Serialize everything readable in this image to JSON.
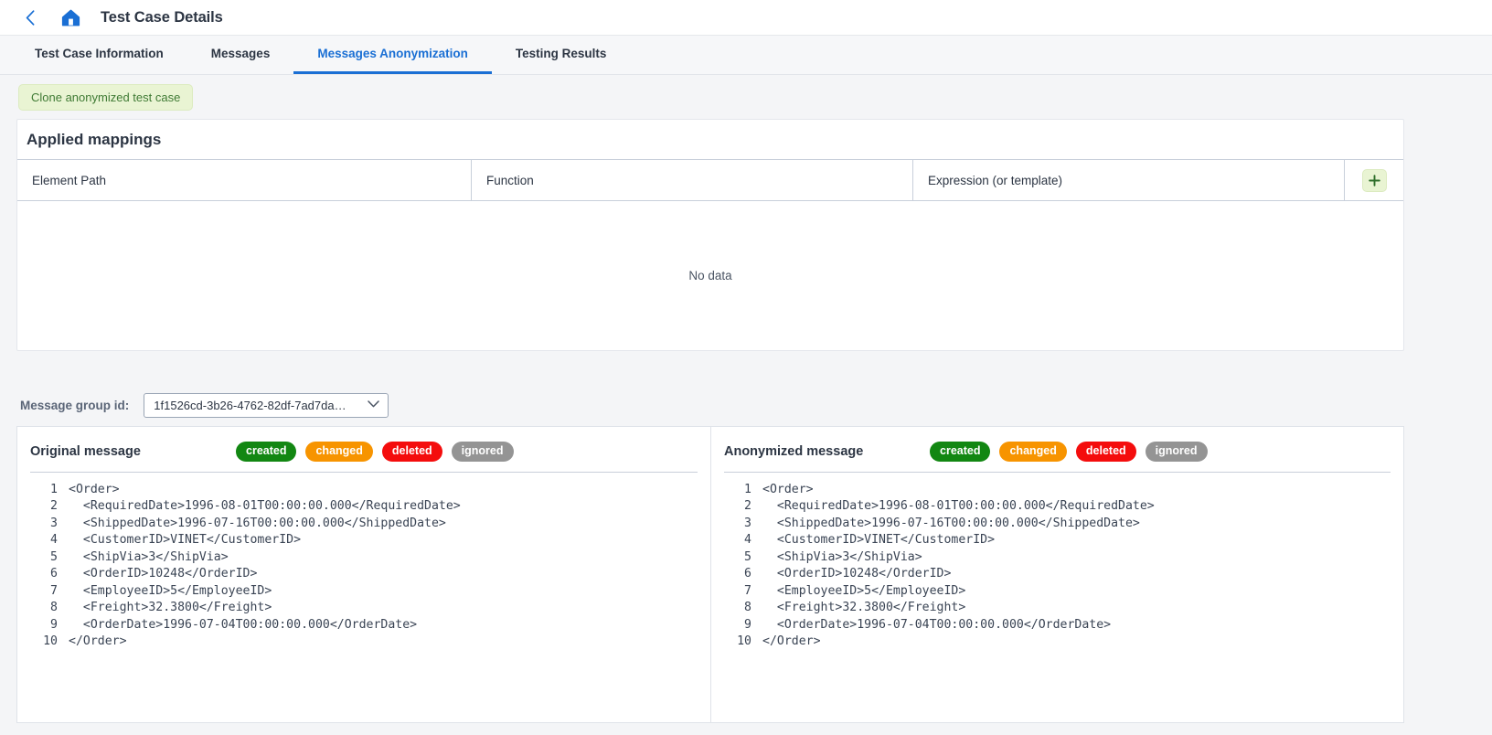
{
  "header": {
    "back_icon": "chevron-left-icon",
    "home_icon": "home-icon",
    "title": "Test Case Details"
  },
  "tabs": [
    {
      "label": "Test Case Information",
      "active": false
    },
    {
      "label": "Messages",
      "active": false
    },
    {
      "label": "Messages Anonymization",
      "active": true
    },
    {
      "label": "Testing Results",
      "active": false
    }
  ],
  "actions": {
    "clone_label": "Clone anonymized test case"
  },
  "mappings": {
    "title": "Applied mappings",
    "columns": [
      "Element Path",
      "Function",
      "Expression (or template)"
    ],
    "add_icon": "plus-icon",
    "empty_text": "No data"
  },
  "message_group": {
    "label": "Message group id:",
    "selected": "1f1526cd-3b26-4762-82df-7ad7da…",
    "chevron_icon": "chevron-down-icon"
  },
  "badges": [
    {
      "label": "created",
      "color": "#128712"
    },
    {
      "label": "changed",
      "color": "#f79400"
    },
    {
      "label": "deleted",
      "color": "#f40d0d"
    },
    {
      "label": "ignored",
      "color": "#949494"
    }
  ],
  "panels": {
    "original": {
      "title": "Original message",
      "lines": [
        "<Order>",
        "  <RequiredDate>1996-08-01T00:00:00.000</RequiredDate>",
        "  <ShippedDate>1996-07-16T00:00:00.000</ShippedDate>",
        "  <CustomerID>VINET</CustomerID>",
        "  <ShipVia>3</ShipVia>",
        "  <OrderID>10248</OrderID>",
        "  <EmployeeID>5</EmployeeID>",
        "  <Freight>32.3800</Freight>",
        "  <OrderDate>1996-07-04T00:00:00.000</OrderDate>",
        "</Order>"
      ]
    },
    "anonymized": {
      "title": "Anonymized message",
      "lines": [
        "<Order>",
        "  <RequiredDate>1996-08-01T00:00:00.000</RequiredDate>",
        "  <ShippedDate>1996-07-16T00:00:00.000</ShippedDate>",
        "  <CustomerID>VINET</CustomerID>",
        "  <ShipVia>3</ShipVia>",
        "  <OrderID>10248</OrderID>",
        "  <EmployeeID>5</EmployeeID>",
        "  <Freight>32.3800</Freight>",
        "  <OrderDate>1996-07-04T00:00:00.000</OrderDate>",
        "</Order>"
      ]
    }
  },
  "colors": {
    "accent": "#1a6fd4",
    "page_bg": "#f4f5f7",
    "green_btn_bg": "#e9f4d3",
    "green_btn_text": "#3f7a34"
  }
}
